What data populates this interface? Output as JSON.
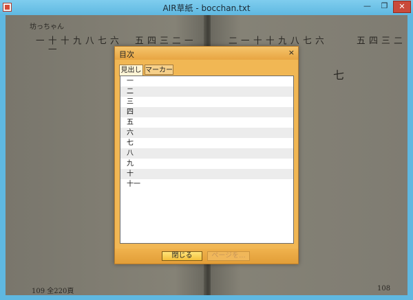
{
  "window": {
    "title": "AIR草紙 - bocchan.txt"
  },
  "book": {
    "left_header": "坊っちゃん",
    "chapter_title": "七",
    "footer_left": "109  全220頁",
    "footer_right": "108"
  },
  "dialog": {
    "title": "目次",
    "close_glyph": "×",
    "tabs": [
      "見出し",
      "マーカー"
    ],
    "entries": [
      "一",
      "二",
      "三",
      "四",
      "五",
      "六",
      "七",
      "八",
      "九",
      "十",
      "十一"
    ],
    "buttons": {
      "close": "閉じる",
      "goto_page": "ページを..."
    }
  }
}
